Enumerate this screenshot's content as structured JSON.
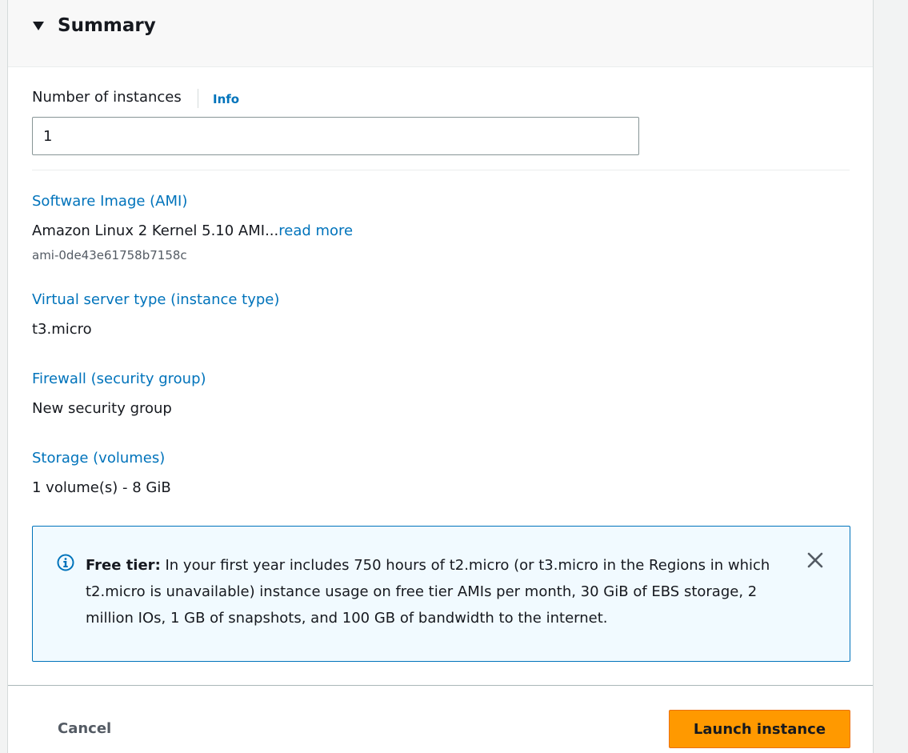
{
  "summary": {
    "title": "Summary"
  },
  "instances": {
    "label": "Number of instances",
    "info": "Info",
    "value": "1"
  },
  "ami": {
    "label": "Software Image (AMI)",
    "name": "Amazon Linux 2 Kernel 5.10 AMI...",
    "read_more": "read more",
    "id": "ami-0de43e61758b7158c"
  },
  "instance_type": {
    "label": "Virtual server type (instance type)",
    "value": "t3.micro"
  },
  "firewall": {
    "label": "Firewall (security group)",
    "value": "New security group"
  },
  "storage": {
    "label": "Storage (volumes)",
    "value": "1 volume(s) - 8 GiB"
  },
  "free_tier": {
    "title": "Free tier:",
    "text": " In your first year includes 750 hours of t2.micro (or t3.micro in the Regions in which t2.micro is unavailable) instance usage on free tier AMIs per month, 30 GiB of EBS storage, 2 million IOs, 1 GB of snapshots, and 100 GB of bandwidth to the internet.",
    "icon": "info-circle-icon"
  },
  "actions": {
    "cancel": "Cancel",
    "launch": "Launch instance"
  },
  "colors": {
    "link": "#0073bb",
    "primary_button": "#ff9900",
    "alert_background": "#f1faff"
  }
}
